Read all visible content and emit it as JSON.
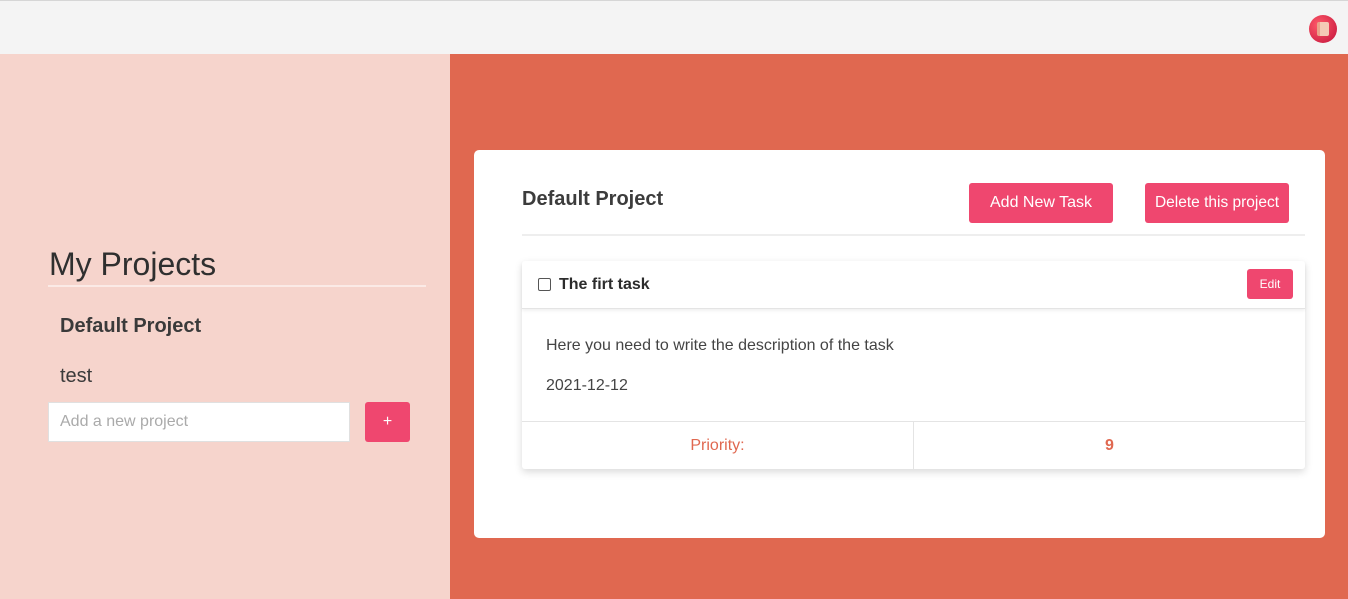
{
  "topbar": {
    "extension_icon": "extension-icon"
  },
  "sidebar": {
    "title": "My Projects",
    "projects": [
      {
        "label": "Default Project",
        "active": true
      },
      {
        "label": "test",
        "active": false
      }
    ],
    "new_project": {
      "placeholder": "Add a new project",
      "value": "",
      "add_label": "+"
    }
  },
  "main": {
    "project_title": "Default Project",
    "add_task_label": "Add New Task",
    "delete_project_label": "Delete this project",
    "tasks": [
      {
        "name": "The firt task",
        "completed": false,
        "edit_label": "Edit",
        "description": "Here you need to write the description of the task",
        "date": "2021-12-12",
        "priority_label": "Priority:",
        "priority_value": "9"
      }
    ]
  },
  "colors": {
    "accent": "#ef476f",
    "sidebar_bg": "#f6d4cc",
    "main_bg": "#e06850",
    "priority_text": "#e06850"
  }
}
